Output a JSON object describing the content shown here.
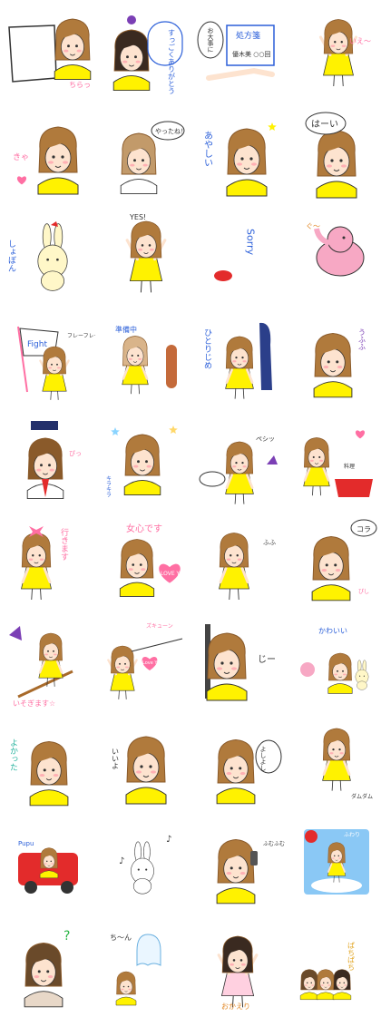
{
  "sheet": {
    "columns": 4,
    "rows": 10,
    "colors": {
      "hair": "#b07a3c",
      "hair_dark": "#8a5a2a",
      "skin": "#fde3cf",
      "dress": "#fff200",
      "outline": "#333333",
      "blush": "#ff9aa8",
      "pink": "#ff6fa3",
      "blue": "#2b5fd9",
      "red": "#e32b2b",
      "purple": "#7b3fb5"
    }
  },
  "stickers": [
    {
      "id": 1,
      "label": "ちらっ",
      "icon": "peeking-girl-paper"
    },
    {
      "id": 2,
      "label": "すっごくありがとう",
      "icon": "thanks-bubble"
    },
    {
      "id": 3,
      "label": "お大事に",
      "icon": "medicine-card",
      "card_text": "処方箋",
      "card_sub": "優木美 ○○回"
    },
    {
      "id": 4,
      "label": "いえ〜",
      "icon": "cheer-girl"
    },
    {
      "id": 5,
      "label": "きゃ",
      "icon": "blushing-girl"
    },
    {
      "id": 6,
      "label": "やったね！",
      "icon": "resting-girl"
    },
    {
      "id": 7,
      "label": "あやしい",
      "icon": "suspicious-girl"
    },
    {
      "id": 8,
      "label": "はーい",
      "icon": "yes-girl"
    },
    {
      "id": 9,
      "label": "しょぼん",
      "icon": "sad-bunny"
    },
    {
      "id": 10,
      "label": "YES!",
      "icon": "yes-raise"
    },
    {
      "id": 11,
      "label": "Sorry",
      "icon": "sorry-lips"
    },
    {
      "id": 12,
      "label": "ぐ〜",
      "icon": "pink-elephant"
    },
    {
      "id": 13,
      "label": "Fight",
      "icon": "fight-flag",
      "side": "フレーフレー"
    },
    {
      "id": 14,
      "label": "準備中",
      "icon": "mirror-girl"
    },
    {
      "id": 15,
      "label": "ひとりじめ",
      "icon": "curtain-girl"
    },
    {
      "id": 16,
      "label": "うふふ",
      "icon": "giggle-girl"
    },
    {
      "id": 17,
      "label": "ぴっ",
      "icon": "salute-girl"
    },
    {
      "id": 18,
      "label": "キラキラ",
      "icon": "sparkle-girl"
    },
    {
      "id": 19,
      "label": "ペシッ",
      "icon": "slap-girl"
    },
    {
      "id": 20,
      "label": "料理",
      "icon": "cooking-girl"
    },
    {
      "id": 21,
      "label": "行きます",
      "icon": "go-girl"
    },
    {
      "id": 22,
      "label": "女心です",
      "icon": "heart-girl",
      "heart_text": "LOVE YOU"
    },
    {
      "id": 23,
      "label": "ふふ",
      "icon": "sit-girl"
    },
    {
      "id": 24,
      "label": "コラ",
      "icon": "scold-girl",
      "side": "ぴし"
    },
    {
      "id": 25,
      "label": "いそぎます☆",
      "icon": "broom-girl"
    },
    {
      "id": 26,
      "label": "ズキューン",
      "icon": "cupid-girl",
      "heart_text": "Love You"
    },
    {
      "id": 27,
      "label": "じー",
      "icon": "stare-girl"
    },
    {
      "id": 28,
      "label": "かわいい",
      "icon": "cute-friends"
    },
    {
      "id": 29,
      "label": "よかった",
      "icon": "relieved-girl"
    },
    {
      "id": 30,
      "label": "いいよ",
      "icon": "ok-girl"
    },
    {
      "id": 31,
      "label": "よしよし",
      "icon": "pat-girl"
    },
    {
      "id": 32,
      "label": "ダムダム",
      "icon": "stomp-girl"
    },
    {
      "id": 33,
      "label": "Pupu",
      "icon": "car-girl"
    },
    {
      "id": 34,
      "label": "♪",
      "icon": "music-bunny"
    },
    {
      "id": 35,
      "label": "ふむふむ",
      "icon": "phone-girl"
    },
    {
      "id": 36,
      "label": "ふわり",
      "icon": "sky-girl"
    },
    {
      "id": 37,
      "label": "?",
      "icon": "question-girl"
    },
    {
      "id": 38,
      "label": "ち〜ん",
      "icon": "ghost-girl"
    },
    {
      "id": 39,
      "label": "おかえり",
      "icon": "welcome-girl"
    },
    {
      "id": 40,
      "label": "ぱちぱち",
      "icon": "clap-trio"
    }
  ]
}
